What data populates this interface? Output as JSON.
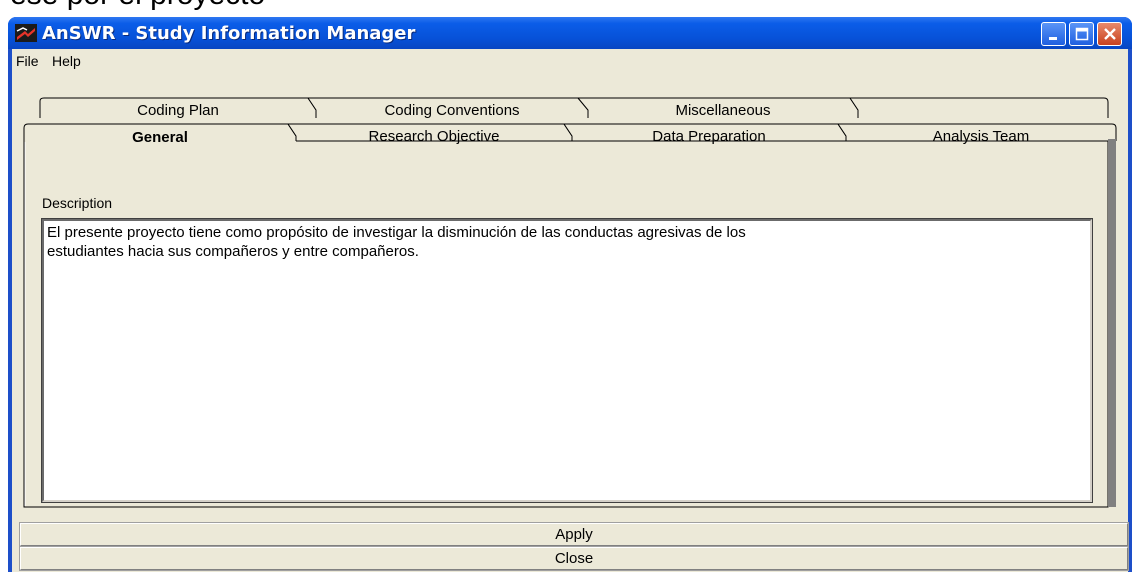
{
  "background_text": "ese por el proyecto",
  "window": {
    "title": "AnSWR - Study Information Manager",
    "controls": [
      "minimize",
      "maximize",
      "close"
    ]
  },
  "menu": {
    "items": [
      "File",
      "Help"
    ]
  },
  "tabs": {
    "back_row": [
      "Coding Plan",
      "Coding Conventions",
      "Miscellaneous",
      ""
    ],
    "front_row": [
      "General",
      "Research Objective",
      "Data Preparation",
      "Analysis Team"
    ],
    "active": "General"
  },
  "general": {
    "description_label": "Description",
    "description_text": "El presente proyecto tiene como propósito de investigar la disminución de las conductas agresivas de los\nestudiantes hacia sus compañeros y entre compañeros."
  },
  "buttons": {
    "apply": "Apply",
    "close": "Close"
  },
  "colors": {
    "titlebar": "#0752d9",
    "face": "#ece9d8",
    "close_button": "#c8421f"
  },
  "icons": [
    "app-logo-icon",
    "minimize-icon",
    "maximize-icon",
    "close-icon"
  ]
}
